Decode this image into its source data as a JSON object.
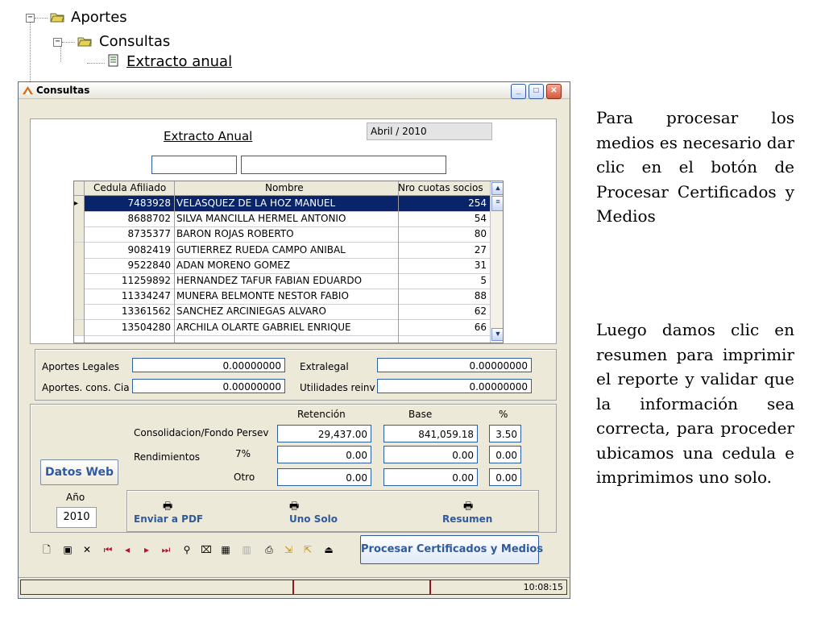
{
  "tree": {
    "root": "Aportes",
    "child": "Consultas",
    "leaf": "Extracto anual"
  },
  "window": {
    "title": "Consultas"
  },
  "form": {
    "heading": "Extracto Anual",
    "period": "Abril / 2010",
    "filter1": "",
    "filter2": ""
  },
  "grid": {
    "columns": [
      "Cedula Afiliado",
      "Nombre",
      "Nro cuotas socios"
    ],
    "rows": [
      {
        "cedula": "7483928",
        "nombre": "VELASQUEZ DE LA HOZ MANUEL",
        "cuotas": "254"
      },
      {
        "cedula": "8688702",
        "nombre": "SILVA MANCILLA HERMEL ANTONIO",
        "cuotas": "54"
      },
      {
        "cedula": "8735377",
        "nombre": "BARON ROJAS ROBERTO",
        "cuotas": "80"
      },
      {
        "cedula": "9082419",
        "nombre": "GUTIERREZ RUEDA CAMPO ANIBAL",
        "cuotas": "27"
      },
      {
        "cedula": "9522840",
        "nombre": "ADAN MORENO GOMEZ",
        "cuotas": "31"
      },
      {
        "cedula": "11259892",
        "nombre": "HERNANDEZ TAFUR FABIAN EDUARDO",
        "cuotas": "5"
      },
      {
        "cedula": "11334247",
        "nombre": "MUNERA BELMONTE NESTOR FABIO",
        "cuotas": "88"
      },
      {
        "cedula": "13361562",
        "nombre": "SANCHEZ ARCINIEGAS ALVARO",
        "cuotas": "62"
      },
      {
        "cedula": "13504280",
        "nombre": "ARCHILA OLARTE GABRIEL ENRIQUE",
        "cuotas": "66"
      }
    ]
  },
  "totals": {
    "aportes_legales_label": "Aportes Legales",
    "aportes_legales": "0.00000000",
    "extralegal_label": "Extralegal",
    "extralegal": "0.00000000",
    "aportes_cons_label": "Aportes. cons. Cia",
    "aportes_cons": "0.00000000",
    "utilidades_label": "Utilidades reinv",
    "utilidades": "0.00000000"
  },
  "retencion": {
    "col_retencion": "Retención",
    "col_base": "Base",
    "col_pct": "%",
    "consolidacion_label": "Consolidacion/Fondo Persev",
    "consolidacion_ret": "29,437.00",
    "consolidacion_base": "841,059.18",
    "consolidacion_pct": "3.50",
    "rendimientos_label": "Rendimientos",
    "rend7_label": "7%",
    "rend7_ret": "0.00",
    "rend7_base": "0.00",
    "rend7_pct": "0.00",
    "otro_label": "Otro",
    "otro_ret": "0.00",
    "otro_base": "0.00",
    "otro_pct": "0.00"
  },
  "left_controls": {
    "datos_web": "Datos Web",
    "anio_label": "Año",
    "anio_value": "2010"
  },
  "actions": {
    "pdf": "Enviar a PDF",
    "uno_solo": "Uno Solo",
    "resumen": "Resumen",
    "procesar": "Procesar Certificados y Medios"
  },
  "status": {
    "time": "10:08:15"
  },
  "side_text": {
    "p1": "Para procesar los medios es necesario dar clic en el botón de Procesar Certificados y Medios",
    "p2": "Luego damos clic en resumen para imprimir el reporte y validar que la información sea correcta, para proceder ubicamos una cedula e imprimimos uno solo."
  }
}
